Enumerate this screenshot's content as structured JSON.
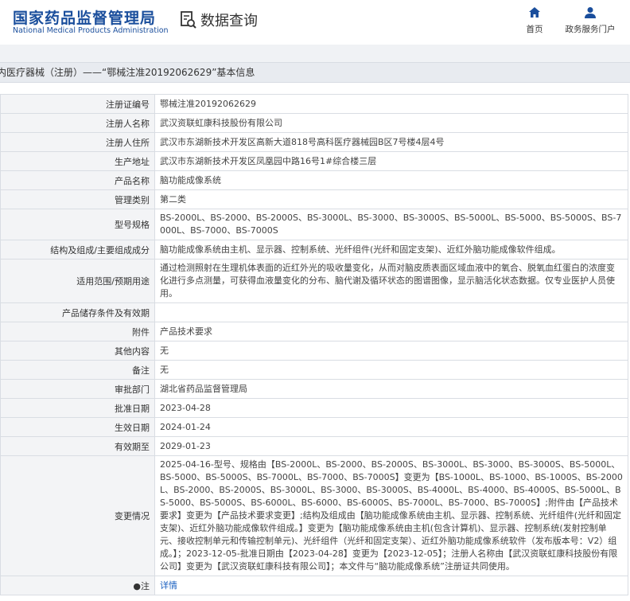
{
  "header": {
    "logo_cn": "国家药品监督管理局",
    "logo_en": "National Medical Products Administration",
    "query_label": "数据查询",
    "nav_home": "首页",
    "nav_gov": "政务服务门户"
  },
  "title": "内医疗器械（注册）——“鄂械注准20192062629”基本信息",
  "rows": [
    {
      "key": "注册证编号",
      "value": "鄂械注准20192062629"
    },
    {
      "key": "注册人名称",
      "value": "武汉资联虹康科技股份有限公司"
    },
    {
      "key": "注册人住所",
      "value": "武汉市东湖新技术开发区高新大道818号高科医疗器械园B区7号楼4层4号"
    },
    {
      "key": "生产地址",
      "value": "武汉市东湖新技术开发区凤凰园中路16号1#综合楼三层"
    },
    {
      "key": "产品名称",
      "value": "脑功能成像系统"
    },
    {
      "key": "管理类别",
      "value": "第二类"
    },
    {
      "key": "型号规格",
      "value": "BS-2000L、BS-2000、BS-2000S、BS-3000L、BS-3000、BS-3000S、BS-5000L、BS-5000、BS-5000S、BS-7000L、BS-7000、BS-7000S"
    },
    {
      "key": "结构及组成/主要组成成分",
      "value": "脑功能成像系统由主机、显示器、控制系统、光纤组件(光纤和固定支架)、近红外脑功能成像软件组成。"
    },
    {
      "key": "适用范围/预期用途",
      "value": "通过检测照射在生理机体表面的近红外光的吸收量变化，从而对脑皮质表面区域血液中的氧合、脱氧血红蛋白的浓度变化进行多点测量，可获得血液量变化的分布、脑代谢及循环状态的图谱图像，显示脑活化状态数据。仅专业医护人员使用。"
    },
    {
      "key": "产品储存条件及有效期",
      "value": ""
    },
    {
      "key": "附件",
      "value": "产品技术要求"
    },
    {
      "key": "其他内容",
      "value": "无"
    },
    {
      "key": "备注",
      "value": "无"
    },
    {
      "key": "审批部门",
      "value": "湖北省药品监督管理局"
    },
    {
      "key": "批准日期",
      "value": "2023-04-28"
    },
    {
      "key": "生效日期",
      "value": "2024-01-24"
    },
    {
      "key": "有效期至",
      "value": "2029-01-23"
    },
    {
      "key": "变更情况",
      "value": "2025-04-16-型号、规格由【BS-2000L、BS-2000、BS-2000S、BS-3000L、BS-3000、BS-3000S、BS-5000L、BS-5000、BS-5000S、BS-7000L、BS-7000、BS-7000S】变更为【BS-1000L、BS-1000、BS-1000S、BS-2000L、BS-2000、BS-2000S、BS-3000L、BS-3000、BS-3000S、BS-4000L、BS-4000、BS-4000S、BS-5000L、BS-5000、BS-5000S、BS-6000L、BS-6000、BS-6000S、BS-7000L、BS-7000、BS-7000S】;附件由【产品技术要求】变更为【产品技术要求变更】;结构及组成由【脑功能成像系统由主机、显示器、控制系统、光纤组件(光纤和固定支架)、近红外脑功能成像软件组成。】变更为【脑功能成像系统由主机(包含计算机)、显示器、控制系统(发射控制单元、接收控制单元和传输控制单元)、光纤组件（光纤和固定支架）、近红外脑功能成像系统软件（发布版本号：V2）组成。】；2023-12-05-批准日期由【2023-04-28】变更为【2023-12-05】；注册人名称由【武汉资联虹康科技股份有限公司】变更为【武汉资联虹康科技有限公司】；本文件与“脑功能成像系统”注册证共同使用。"
    }
  ],
  "note_key": "注",
  "note_value": "详情",
  "colors": {
    "brand": "#1a4e9c",
    "link": "#1a60c0"
  }
}
